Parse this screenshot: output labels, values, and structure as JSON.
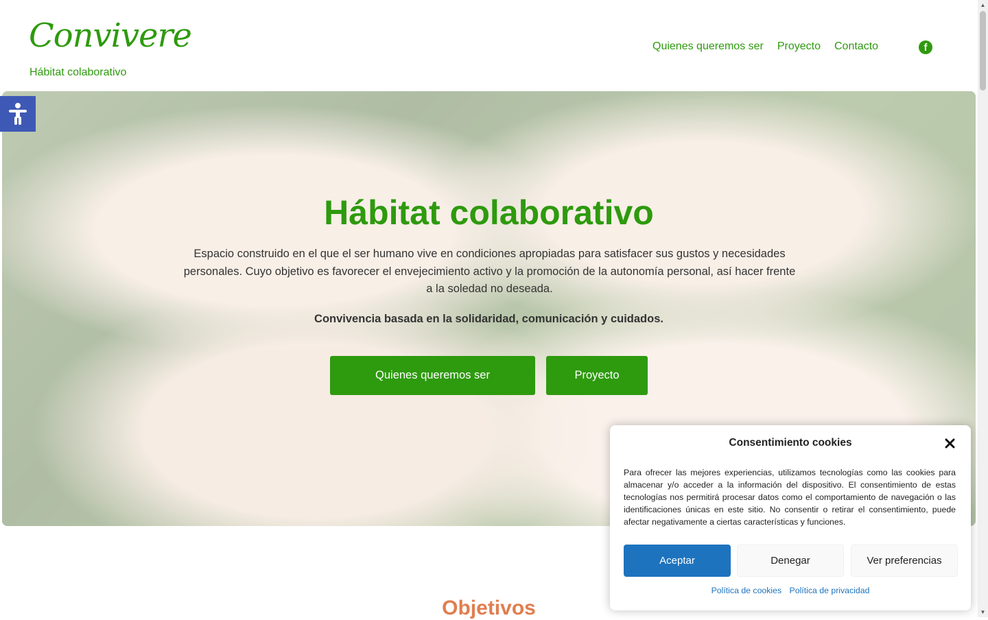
{
  "header": {
    "logo": "Convivere",
    "tagline": "Hábitat colaborativo",
    "nav": [
      "Quienes queremos ser",
      "Proyecto",
      "Contacto"
    ],
    "facebook_icon": "facebook-icon"
  },
  "hero": {
    "title": "Hábitat colaborativo",
    "text": "Espacio construido en el que el ser humano vive en condiciones apropiadas para satisfacer sus gustos y necesidades personales. Cuyo objetivo es favorecer el envejecimiento activo y la promoción de la autonomía personal, así hacer frente a la soledad no deseada.",
    "bold": "Convivencia basada en la solidaridad, comunicación y cuidados.",
    "buttons": [
      "Quienes queremos ser",
      "Proyecto"
    ]
  },
  "section": {
    "title": "Objetivos"
  },
  "cookie": {
    "title": "Consentimiento cookies",
    "text": "Para ofrecer las mejores experiencias, utilizamos tecnologías como las cookies para almacenar y/o acceder a la información del dispositivo. El consentimiento de estas tecnologías nos permitirá procesar datos como el comportamiento de navegación o las identificaciones únicas en este sitio. No consentir o retirar el consentimiento, puede afectar negativamente a ciertas características y funciones.",
    "accept": "Aceptar",
    "deny": "Denegar",
    "prefs": "Ver preferencias",
    "links": [
      "Política de cookies",
      "Política de privacidad"
    ]
  },
  "colors": {
    "brand_green": "#2e9a0e",
    "accent_orange": "#e07e4f",
    "accept_blue": "#1e73be",
    "accessibility_blue": "#3e59b5"
  }
}
